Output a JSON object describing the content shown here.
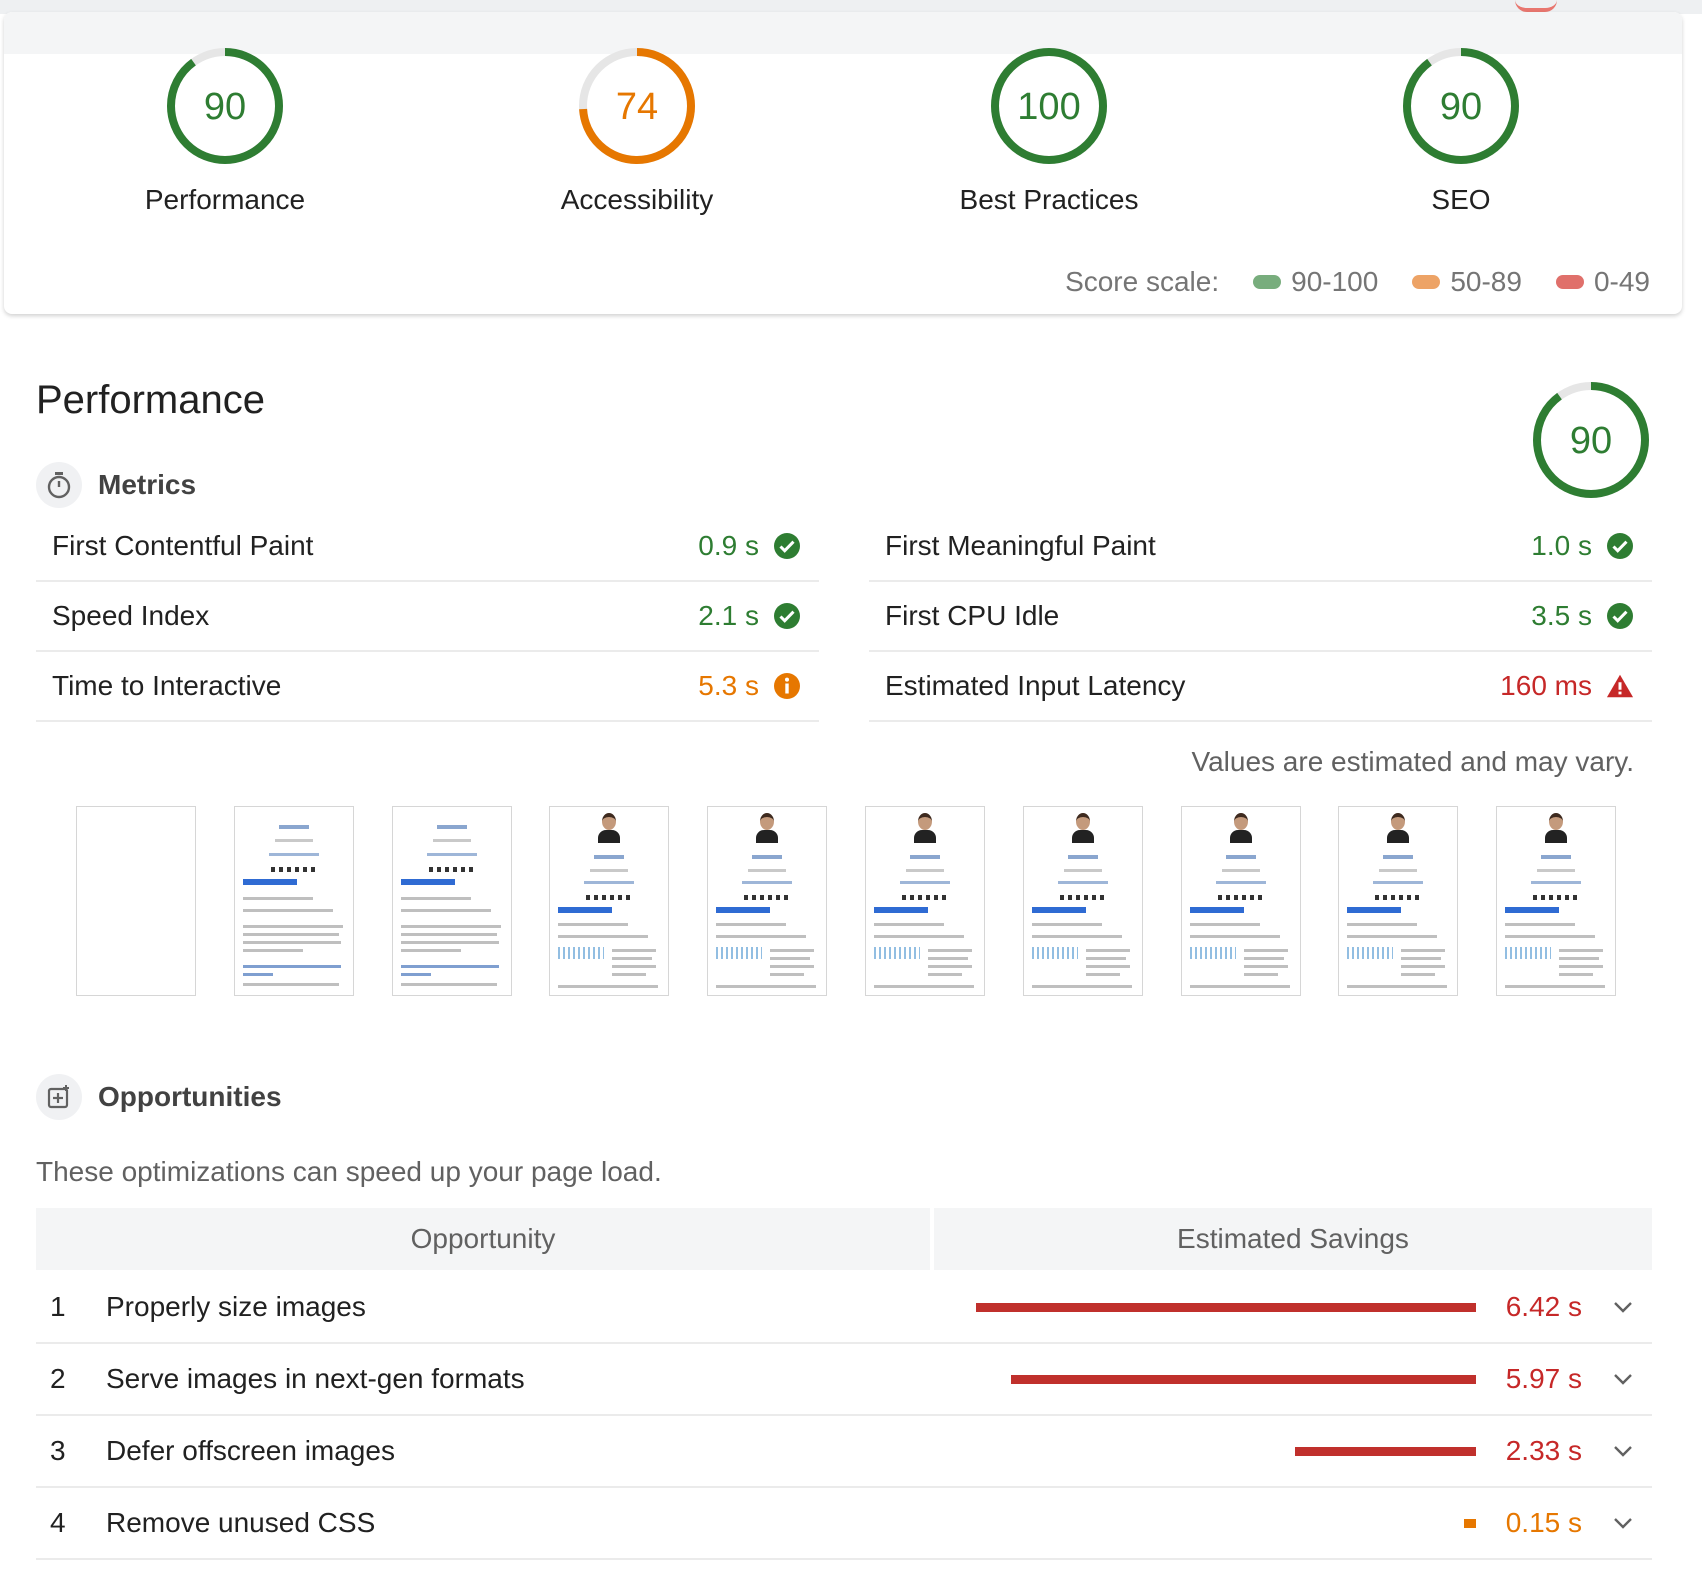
{
  "summary": {
    "gauges": [
      {
        "value": "90",
        "label": "Performance",
        "score": 0.9,
        "color": "#2e7d32",
        "track": "#e6e6e6"
      },
      {
        "value": "74",
        "label": "Accessibility",
        "score": 0.74,
        "color": "#e67700",
        "track": "#e6e6e6"
      },
      {
        "value": "100",
        "label": "Best Practices",
        "score": 1.0,
        "color": "#2e7d32",
        "track": "#e6e6e6"
      },
      {
        "value": "90",
        "label": "SEO",
        "score": 0.9,
        "color": "#2e7d32",
        "track": "#e6e6e6"
      }
    ],
    "scale_label": "Score scale:",
    "scale": [
      {
        "range": "90-100",
        "color": "#78ad7d"
      },
      {
        "range": "50-89",
        "color": "#eda366"
      },
      {
        "range": "0-49",
        "color": "#e0706b"
      }
    ]
  },
  "performance": {
    "title": "Performance",
    "score": "90",
    "score_fraction": 0.9,
    "metrics_heading": "Metrics",
    "metrics": [
      {
        "name": "First Contentful Paint",
        "value": "0.9 s",
        "status": "pass"
      },
      {
        "name": "First Meaningful Paint",
        "value": "1.0 s",
        "status": "pass"
      },
      {
        "name": "Speed Index",
        "value": "2.1 s",
        "status": "pass"
      },
      {
        "name": "First CPU Idle",
        "value": "3.5 s",
        "status": "pass"
      },
      {
        "name": "Time to Interactive",
        "value": "5.3 s",
        "status": "average"
      },
      {
        "name": "Estimated Input Latency",
        "value": "160 ms",
        "status": "fail"
      }
    ],
    "note": "Values are estimated and may vary.",
    "filmstrip_frames": 10
  },
  "opportunities": {
    "heading": "Opportunities",
    "intro": "These optimizations can speed up your page load.",
    "col_opportunity": "Opportunity",
    "col_savings": "Estimated Savings",
    "rows": [
      {
        "num": "1",
        "title": "Properly size images",
        "savings": "6.42 s",
        "seconds": 6.42,
        "status": "fail"
      },
      {
        "num": "2",
        "title": "Serve images in next-gen formats",
        "savings": "5.97 s",
        "seconds": 5.97,
        "status": "fail"
      },
      {
        "num": "3",
        "title": "Defer offscreen images",
        "savings": "2.33 s",
        "seconds": 2.33,
        "status": "fail"
      },
      {
        "num": "4",
        "title": "Remove unused CSS",
        "savings": "0.15 s",
        "seconds": 0.15,
        "status": "average"
      }
    ]
  },
  "colors": {
    "pass": "#2e7d32",
    "average": "#e67700",
    "fail": "#c62828"
  }
}
